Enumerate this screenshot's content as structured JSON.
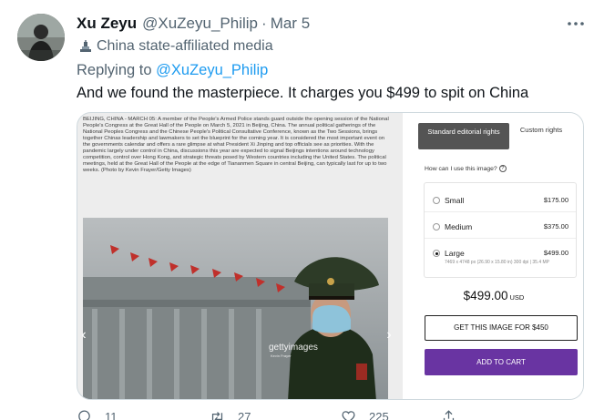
{
  "tweet": {
    "name": "Xu Zeyu",
    "handle": "@XuZeyu_Philip",
    "separator": "·",
    "date": "Mar 5",
    "label": "China state-affiliated media",
    "reply_prefix": "Replying to ",
    "reply_handle": "@XuZeyu_Philip",
    "text": "And we found the masterpiece. It charges you $499 to spit on China",
    "more_icon": "more-dots-icon",
    "label_icon": "state-media-icon"
  },
  "media": {
    "caption": "BEIJING, CHINA - MARCH 05: A member of the People's Armed Police stands guard outside the opening session of the National People's Congress at the Great Hall of the People on March 5, 2021 in Beijing, China. The annual political gatherings of the National Peoples Congress and the Chinese People's Political Consultative Conference, known as the Two Sessions, brings together Chinas leadership and lawmakers to set the blueprint for the coming year. It is considered the most important event on the governments calendar and offers a rare glimpse at what President Xi Jinping and top officials see as priorities. With the pandemic largely under control in China, discussions this year are expected to signal Beijings intentions around technology competition, control over Hong Kong, and strategic threats posed by Western countries including the United States. The political meetings, held at the Great Hall of the People at the edge of Tiananmen Square in central Beijing, can typically last for up to two weeks. (Photo by Kevin Frayer/Getty Images)",
    "watermark": "gettyimages",
    "watermark_credit": "Kevin Frayer",
    "prev_icon": "chevron-left-icon",
    "next_icon": "chevron-right-icon"
  },
  "panel": {
    "tab_standard": "Standard editorial rights",
    "tab_custom": "Custom rights",
    "howto": "How can I use this image?",
    "sizes": [
      {
        "name": "Small",
        "price": "$175.00",
        "selected": false,
        "desc": ""
      },
      {
        "name": "Medium",
        "price": "$375.00",
        "selected": false,
        "desc": ""
      },
      {
        "name": "Large",
        "price": "$499.00",
        "selected": true,
        "desc": "7469 x 4748 px (26.90 x 15.80 in) 300 dpi | 35.4 MP"
      }
    ],
    "total": "$499.00",
    "currency": "USD",
    "get_button": "GET THIS IMAGE FOR $450",
    "cart_button": "ADD TO CART"
  },
  "actions": {
    "reply_count": "11",
    "retweet_count": "27",
    "like_count": "225",
    "icons": [
      "reply-icon",
      "retweet-icon",
      "like-icon",
      "share-icon"
    ]
  },
  "colors": {
    "link": "#1d9bf0",
    "muted": "#536471",
    "cart": "#6934a2",
    "standard_tab": "#545454"
  }
}
